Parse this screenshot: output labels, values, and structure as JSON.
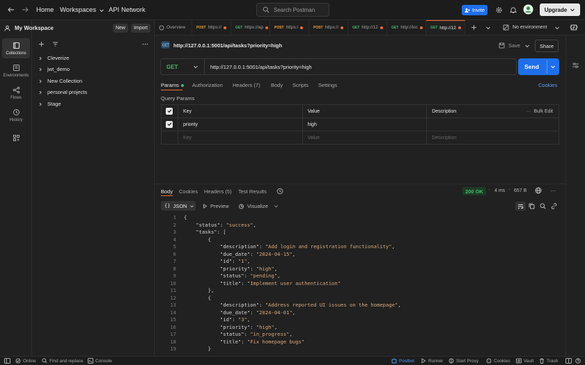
{
  "topbar": {
    "home": "Home",
    "workspaces": "Workspaces",
    "api_network": "API Network",
    "search_placeholder": "Search Postman",
    "invite": "Invite",
    "upgrade": "Upgrade"
  },
  "rail": {
    "items": [
      {
        "label": "Collections"
      },
      {
        "label": "Environments"
      },
      {
        "label": "Flows"
      },
      {
        "label": "History"
      }
    ]
  },
  "sidebar": {
    "workspace": "My Workspace",
    "new_label": "New",
    "import_label": "Import",
    "collections": [
      {
        "label": "Cleverize"
      },
      {
        "label": "jwt_demo"
      },
      {
        "label": "New Collection"
      },
      {
        "label": "personal projects"
      },
      {
        "label": "Stage"
      }
    ]
  },
  "tabs": {
    "overview": "Overview",
    "items": [
      {
        "method": "POST",
        "label": "https://"
      },
      {
        "method": "GET",
        "label": "https://ap"
      },
      {
        "method": "POST",
        "label": "https:/"
      },
      {
        "method": "POST",
        "label": "https://"
      },
      {
        "method": "GET",
        "label": "http://12"
      },
      {
        "method": "GET",
        "label": "http://loc"
      },
      {
        "method": "GET",
        "label": "http://12"
      }
    ],
    "environment": "No environment"
  },
  "request": {
    "title": "http://127.0.0.1:5001/api/tasks?priority=high",
    "save": "Save",
    "share": "Share",
    "method": "GET",
    "url": "http://127.0.0.1:5001/api/tasks?priority=high",
    "send": "Send",
    "subtabs": {
      "params": "Params",
      "authorization": "Authorization",
      "headers": "Headers (7)",
      "body": "Body",
      "scripts": "Scripts",
      "settings": "Settings",
      "cookies": "Cookies"
    },
    "query_params_label": "Query Params",
    "table": {
      "key_header": "Key",
      "value_header": "Value",
      "description_header": "Description",
      "bulk_edit": "Bulk Edit",
      "row_key": "priority",
      "row_value": "high",
      "key_placeholder": "Key",
      "value_placeholder": "Value",
      "description_placeholder": "Description"
    }
  },
  "response": {
    "tabs": {
      "body": "Body",
      "cookies": "Cookies",
      "headers": "Headers (5)",
      "test_results": "Test Results"
    },
    "status": "200 OK",
    "time": "4 ms",
    "size": "657 B",
    "format": "JSON",
    "preview": "Preview",
    "visualize": "Visualize",
    "lines": [
      {
        "n": "1",
        "t": "{"
      },
      {
        "n": "2",
        "t": "    \"status\": \"success\","
      },
      {
        "n": "3",
        "t": "    \"tasks\": ["
      },
      {
        "n": "4",
        "t": "        {"
      },
      {
        "n": "5",
        "t": "            \"description\": \"Add login and registration functionality\","
      },
      {
        "n": "6",
        "t": "            \"due_date\": \"2024-04-15\","
      },
      {
        "n": "7",
        "t": "            \"id\": \"1\","
      },
      {
        "n": "8",
        "t": "            \"priority\": \"high\","
      },
      {
        "n": "9",
        "t": "            \"status\": \"pending\","
      },
      {
        "n": "10",
        "t": "            \"title\": \"Implement user authentication\""
      },
      {
        "n": "11",
        "t": "        },"
      },
      {
        "n": "12",
        "t": "        {"
      },
      {
        "n": "13",
        "t": "            \"description\": \"Address reported UI issues on the homepage\","
      },
      {
        "n": "14",
        "t": "            \"due_date\": \"2024-04-01\","
      },
      {
        "n": "15",
        "t": "            \"id\": \"3\","
      },
      {
        "n": "16",
        "t": "            \"priority\": \"high\","
      },
      {
        "n": "17",
        "t": "            \"status\": \"in_progress\","
      },
      {
        "n": "18",
        "t": "            \"title\": \"Fix homepage bugs\""
      },
      {
        "n": "19",
        "t": "        }"
      }
    ]
  },
  "statusbar": {
    "online": "Online",
    "find_replace": "Find and replace",
    "console": "Console",
    "postbot": "Postbot",
    "runner": "Runner",
    "start_proxy": "Start Proxy",
    "cookies": "Cookies",
    "vault": "Vault",
    "trash": "Trash"
  },
  "colors": {
    "accent_blue": "#1f6feb",
    "post_orange": "#f2a23a",
    "get_green": "#49b86b",
    "status_green": "#49b86b"
  }
}
